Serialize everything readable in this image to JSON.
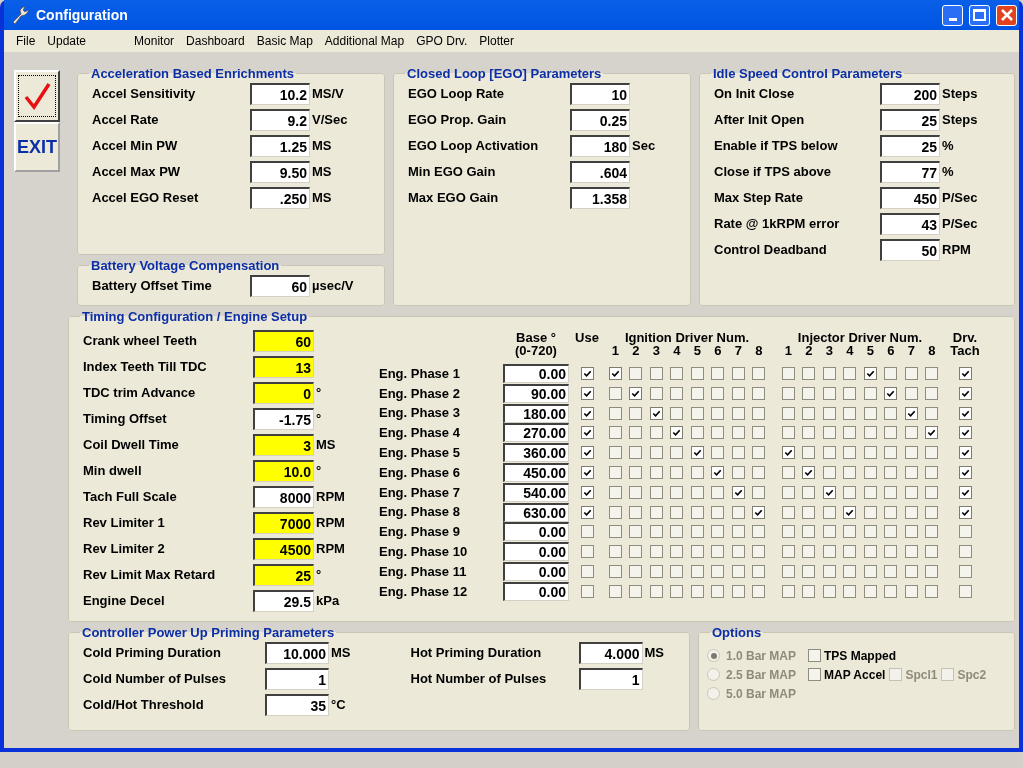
{
  "window": {
    "title": "Configuration"
  },
  "menu": [
    {
      "label": "File"
    },
    {
      "label": "Update"
    },
    {
      "label": "Monitor",
      "gap": true
    },
    {
      "label": "Dashboard"
    },
    {
      "label": "Basic Map"
    },
    {
      "label": "Additional Map"
    },
    {
      "label": "GPO Drv."
    },
    {
      "label": "Plotter"
    }
  ],
  "side_buttons": [
    {
      "kind": "check",
      "focused": true
    },
    {
      "kind": "text",
      "label": "EXIT"
    }
  ],
  "accel": {
    "title": "Acceleration Based Enrichments",
    "fields": [
      {
        "label": "Accel Sensitivity",
        "value": "10.2",
        "unit": "MS/V"
      },
      {
        "label": "Accel Rate",
        "value": "9.2",
        "unit": "V/Sec"
      },
      {
        "label": "Accel Min PW",
        "value": "1.25",
        "unit": "MS"
      },
      {
        "label": "Accel Max PW",
        "value": "9.50",
        "unit": "MS"
      },
      {
        "label": "Accel EGO Reset",
        "value": ".250",
        "unit": "MS"
      }
    ]
  },
  "battery": {
    "title": "Battery Voltage Compensation",
    "fields": [
      {
        "label": "Battery Offset Time",
        "value": "60",
        "unit": "µsec/V"
      }
    ]
  },
  "closed_loop": {
    "title": "Closed Loop [EGO] Parameters",
    "fields": [
      {
        "label": "EGO Loop Rate",
        "value": "10"
      },
      {
        "label": "EGO Prop. Gain",
        "value": "0.25"
      },
      {
        "label": "EGO Loop Activation",
        "value": "180",
        "unit": "Sec"
      },
      {
        "label": "Min EGO Gain",
        "value": ".604"
      },
      {
        "label": "Max EGO Gain",
        "value": "1.358"
      }
    ]
  },
  "idle": {
    "title": "Idle Speed Control Parameters",
    "fields": [
      {
        "label": "On Init Close",
        "value": "200",
        "unit": "Steps"
      },
      {
        "label": "After Init Open",
        "value": "25",
        "unit": "Steps"
      },
      {
        "label": "Enable if TPS below",
        "value": "25",
        "unit": "%"
      },
      {
        "label": "Close if TPS above",
        "value": "77",
        "unit": "%"
      },
      {
        "label": "Max Step Rate",
        "value": "450",
        "unit": "P/Sec"
      },
      {
        "label": "Rate @ 1kRPM error",
        "value": "43",
        "unit": "P/Sec"
      },
      {
        "label": "Control Deadband",
        "value": "50",
        "unit": "RPM"
      }
    ]
  },
  "timing": {
    "title": "Timing Configuration / Engine Setup",
    "fields": [
      {
        "label": "Crank wheel Teeth",
        "value": "60",
        "highlighted": true
      },
      {
        "label": "Index Teeth Till TDC",
        "value": "13",
        "highlighted": true
      },
      {
        "label": "TDC trim Advance",
        "value": "0",
        "unit": "°",
        "highlighted": true
      },
      {
        "label": "Timing Offset",
        "value": "-1.75",
        "unit": "°",
        "highlighted": false
      },
      {
        "label": "Coil Dwell Time",
        "value": "3",
        "unit": "MS",
        "highlighted": true
      },
      {
        "label": "Min dwell",
        "value": "10.0",
        "unit": "°",
        "highlighted": true
      },
      {
        "label": "Tach Full Scale",
        "value": "8000",
        "unit": "RPM",
        "highlighted": false
      },
      {
        "label": "Rev Limiter 1",
        "value": "7000",
        "unit": "RPM",
        "highlighted": true
      },
      {
        "label": "Rev Limiter 2",
        "value": "4500",
        "unit": "RPM",
        "highlighted": true
      },
      {
        "label": "Rev Limit Max Retard",
        "value": "25",
        "unit": "°",
        "highlighted": true
      },
      {
        "label": "Engine Decel",
        "value": "29.5",
        "unit": "kPa",
        "highlighted": false
      }
    ],
    "grid": {
      "base_header": [
        "Base °",
        "(0-720)"
      ],
      "use_header": "Use",
      "ignition_header": "Ignition Driver Num.",
      "ignition_numbers": [
        "1",
        "2",
        "3",
        "4",
        "5",
        "6",
        "7",
        "8"
      ],
      "injector_header": "Injector Driver Num.",
      "injector_numbers": [
        "1",
        "2",
        "3",
        "4",
        "5",
        "6",
        "7",
        "8"
      ],
      "tach_header": [
        "Drv.",
        "Tach"
      ],
      "phases": [
        {
          "label": "Eng. Phase 1",
          "base": "0.00",
          "use": true,
          "ignition": [
            true,
            false,
            false,
            false,
            false,
            false,
            false,
            false
          ],
          "injector": [
            false,
            false,
            false,
            false,
            true,
            false,
            false,
            false
          ],
          "tach": true
        },
        {
          "label": "Eng. Phase 2",
          "base": "90.00",
          "use": true,
          "ignition": [
            false,
            true,
            false,
            false,
            false,
            false,
            false,
            false
          ],
          "injector": [
            false,
            false,
            false,
            false,
            false,
            true,
            false,
            false
          ],
          "tach": true
        },
        {
          "label": "Eng. Phase 3",
          "base": "180.00",
          "use": true,
          "ignition": [
            false,
            false,
            true,
            false,
            false,
            false,
            false,
            false
          ],
          "injector": [
            false,
            false,
            false,
            false,
            false,
            false,
            true,
            false
          ],
          "tach": true
        },
        {
          "label": "Eng. Phase 4",
          "base": "270.00",
          "use": true,
          "ignition": [
            false,
            false,
            false,
            true,
            false,
            false,
            false,
            false
          ],
          "injector": [
            false,
            false,
            false,
            false,
            false,
            false,
            false,
            true
          ],
          "tach": true
        },
        {
          "label": "Eng. Phase 5",
          "base": "360.00",
          "use": true,
          "ignition": [
            false,
            false,
            false,
            false,
            true,
            false,
            false,
            false
          ],
          "injector": [
            true,
            false,
            false,
            false,
            false,
            false,
            false,
            false
          ],
          "tach": true
        },
        {
          "label": "Eng. Phase 6",
          "base": "450.00",
          "use": true,
          "ignition": [
            false,
            false,
            false,
            false,
            false,
            true,
            false,
            false
          ],
          "injector": [
            false,
            true,
            false,
            false,
            false,
            false,
            false,
            false
          ],
          "tach": true
        },
        {
          "label": "Eng. Phase 7",
          "base": "540.00",
          "use": true,
          "ignition": [
            false,
            false,
            false,
            false,
            false,
            false,
            true,
            false
          ],
          "injector": [
            false,
            false,
            true,
            false,
            false,
            false,
            false,
            false
          ],
          "tach": true
        },
        {
          "label": "Eng. Phase 8",
          "base": "630.00",
          "use": true,
          "ignition": [
            false,
            false,
            false,
            false,
            false,
            false,
            false,
            true
          ],
          "injector": [
            false,
            false,
            false,
            true,
            false,
            false,
            false,
            false
          ],
          "tach": true
        },
        {
          "label": "Eng. Phase 9",
          "base": "0.00",
          "use": false,
          "ignition": [
            false,
            false,
            false,
            false,
            false,
            false,
            false,
            false
          ],
          "injector": [
            false,
            false,
            false,
            false,
            false,
            false,
            false,
            false
          ],
          "tach": false
        },
        {
          "label": "Eng. Phase 10",
          "base": "0.00",
          "use": false,
          "ignition": [
            false,
            false,
            false,
            false,
            false,
            false,
            false,
            false
          ],
          "injector": [
            false,
            false,
            false,
            false,
            false,
            false,
            false,
            false
          ],
          "tach": false
        },
        {
          "label": "Eng. Phase 11",
          "base": "0.00",
          "use": false,
          "ignition": [
            false,
            false,
            false,
            false,
            false,
            false,
            false,
            false
          ],
          "injector": [
            false,
            false,
            false,
            false,
            false,
            false,
            false,
            false
          ],
          "tach": false
        },
        {
          "label": "Eng. Phase 12",
          "base": "0.00",
          "use": false,
          "ignition": [
            false,
            false,
            false,
            false,
            false,
            false,
            false,
            false
          ],
          "injector": [
            false,
            false,
            false,
            false,
            false,
            false,
            false,
            false
          ],
          "tach": false
        }
      ]
    }
  },
  "priming": {
    "title": "Controller Power Up Priming Parameters",
    "columns": [
      [
        {
          "label": "Cold Priming Duration",
          "value": "10.000",
          "unit": "MS"
        },
        {
          "label": "Cold Number of Pulses",
          "value": "1"
        },
        {
          "label": "Cold/Hot Threshold",
          "value": "35",
          "unit": "°C"
        }
      ],
      [
        {
          "label": "Hot Priming Duration",
          "value": "4.000",
          "unit": "MS"
        },
        {
          "label": "Hot Number of Pulses",
          "value": "1"
        }
      ]
    ]
  },
  "options": {
    "title": "Options",
    "radios": [
      {
        "label": "1.0 Bar MAP",
        "selected": true,
        "disabled": true
      },
      {
        "label": "2.5 Bar MAP",
        "selected": false,
        "disabled": true
      },
      {
        "label": "5.0 Bar MAP",
        "selected": false,
        "disabled": true
      }
    ],
    "checkboxes": [
      {
        "label": "TPS Mapped",
        "checked": false,
        "disabled": false
      },
      {
        "label": "MAP Accel",
        "checked": false,
        "disabled": false
      },
      {
        "label": "Spcl1",
        "checked": false,
        "disabled": true
      },
      {
        "label": "Spc2",
        "checked": false,
        "disabled": true
      }
    ]
  }
}
